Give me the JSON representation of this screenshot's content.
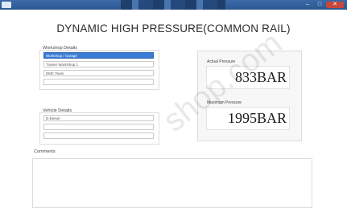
{
  "window": {
    "title": "",
    "minimize": "–",
    "maximize": "□",
    "close": "✕"
  },
  "page_title": "DYNAMIC HIGH PRESSURE(COMMON RAIL)",
  "workshop": {
    "label": "Workshop Details",
    "fields": [
      "Workshop / Garage",
      "Trainer  WorkShop 1",
      "DMC Team",
      ""
    ]
  },
  "vehicle": {
    "label": "Vehicle Details",
    "fields": [
      "D-Diesel",
      "",
      ""
    ]
  },
  "actual_pressure": {
    "label": "Actual Pressure",
    "value": "833BAR"
  },
  "maximum_pressure": {
    "label": "Maximum Pressure",
    "value": "1995BAR"
  },
  "comments": {
    "label": "Comments",
    "value": ""
  },
  "watermark": "shop.com"
}
